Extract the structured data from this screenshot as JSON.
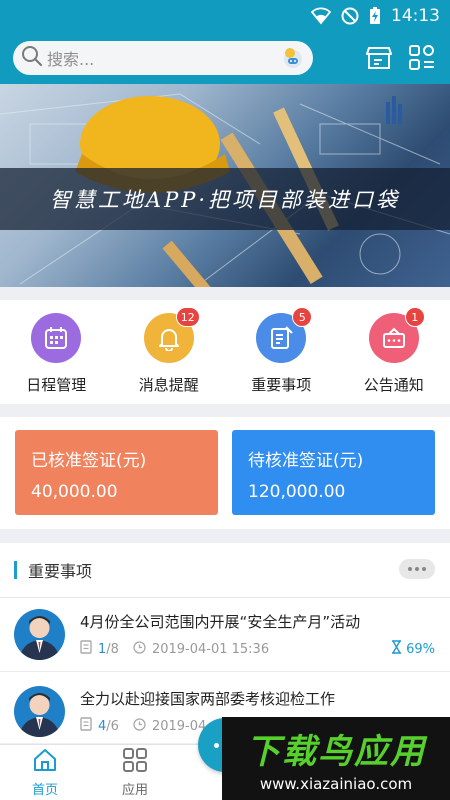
{
  "status": {
    "time": "14:13"
  },
  "header": {
    "search_placeholder": "搜索..."
  },
  "banner": {
    "title": "智慧工地APP·把项目部装进口袋"
  },
  "menu": [
    {
      "label": "日程管理",
      "icon": "calendar-icon",
      "color": "#9d6be0",
      "badge": ""
    },
    {
      "label": "消息提醒",
      "icon": "bell-icon",
      "color": "#f0b43a",
      "badge": "12"
    },
    {
      "label": "重要事项",
      "icon": "document-icon",
      "color": "#4b8ce8",
      "badge": "5"
    },
    {
      "label": "公告通知",
      "icon": "megaphone-icon",
      "color": "#ef5f77",
      "badge": "1"
    }
  ],
  "cards": {
    "approved": {
      "label": "已核准签证(元)",
      "value": "40,000.00",
      "color": "#f0835e"
    },
    "pending": {
      "label": "待核准签证(元)",
      "value": "120,000.00",
      "color": "#2f8ef0"
    }
  },
  "important": {
    "title": "重要事项",
    "items": [
      {
        "title": "4月份全公司范围内开展“安全生产月”活动",
        "done": "1",
        "total": "/8",
        "date": "2019-04-01 15:36",
        "progress": "69%"
      },
      {
        "title": "全力以赴迎接国家两部委考核迎检工作",
        "done": "4",
        "total": "/6",
        "date": "2019-04"
      }
    ]
  },
  "tabs": [
    {
      "label": "首页",
      "active": true
    },
    {
      "label": "应用",
      "active": false
    }
  ],
  "watermark": {
    "logo": "下载鸟应用",
    "url": "www.xiazainiao.com"
  }
}
